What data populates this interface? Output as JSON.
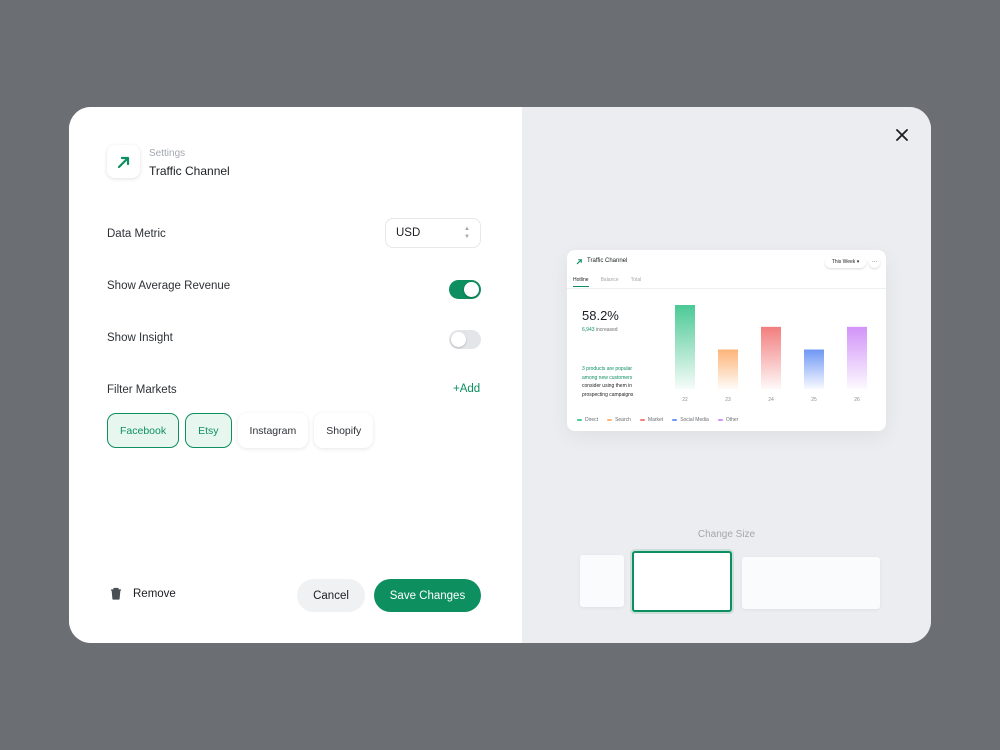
{
  "header": {
    "section": "Settings",
    "title": "Traffic Channel"
  },
  "settings": {
    "data_metric_label": "Data Metric",
    "data_metric_value": "USD",
    "show_avg_revenue_label": "Show Average Revenue",
    "show_avg_revenue_on": true,
    "show_insight_label": "Show Insight",
    "show_insight_on": false,
    "filter_markets_label": "Filter Markets",
    "add_label": "+Add",
    "markets": [
      {
        "label": "Facebook",
        "active": true
      },
      {
        "label": "Etsy",
        "active": true
      },
      {
        "label": "Instagram",
        "active": false
      },
      {
        "label": "Shopify",
        "active": false
      }
    ]
  },
  "footer": {
    "remove_label": "Remove",
    "cancel_label": "Cancel",
    "save_label": "Save Changes"
  },
  "preview": {
    "title": "Traffic Channel",
    "range_label": "This Week",
    "more_label": "···",
    "tabs": [
      "Hotline",
      "Balance",
      "Total"
    ],
    "value": "58.2%",
    "increase_count": "6,943",
    "increase_label": "increased",
    "insight_highlight": "3 products are popular among new customers",
    "insight_rest": "consider using them in prospecting campaigns",
    "change_size_label": "Change Size"
  },
  "colors": {
    "accent": "#0e8f5f",
    "direct": "#4cc995",
    "search": "#fdb478",
    "market": "#f27e7e",
    "social": "#6f97f5",
    "other": "#d193f8"
  },
  "chart_data": {
    "type": "bar",
    "categories": [
      "22",
      "23",
      "24",
      "25",
      "26"
    ],
    "series": [
      {
        "name": "Direct",
        "values": [
          100,
          0,
          0,
          0,
          0
        ]
      },
      {
        "name": "Search",
        "values": [
          0,
          47,
          0,
          0,
          0
        ]
      },
      {
        "name": "Market",
        "values": [
          0,
          0,
          74,
          0,
          0
        ]
      },
      {
        "name": "Social Media",
        "values": [
          0,
          0,
          0,
          47,
          0
        ]
      },
      {
        "name": "Other",
        "values": [
          0,
          0,
          0,
          0,
          74
        ]
      }
    ],
    "ylim": [
      0,
      100
    ],
    "grid": false,
    "legend": "bottom"
  }
}
